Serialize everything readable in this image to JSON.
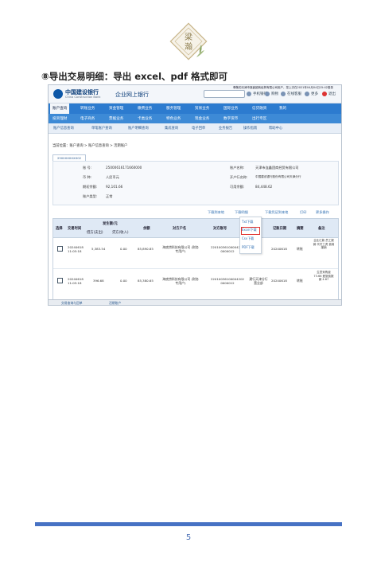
{
  "logo": {
    "text_top": "梁",
    "text_bottom": "瀚",
    "icon": "diamond-leaf-emblem"
  },
  "heading": "⑧导出交易明细：导出 excel、pdf 格式即可",
  "screenshot": {
    "bank_name": "中国建设银行",
    "bank_name_en": "China Construction Bank",
    "portal_name": "企业网上银行",
    "greeting": "尊敬的天津市莲鑫团商经贸有限公司用户，您上次在2021年04月04日15:42登录",
    "top_buttons": [
      "手机银行",
      "购物",
      "在线客服",
      "更多",
      "退出"
    ],
    "menu_row1": [
      "账户查询",
      "转账业务",
      "资金管理",
      "缴费业务",
      "服务管理",
      "贸易业务",
      "国际业务",
      "信贷融资",
      "我的"
    ],
    "menu_row2": [
      "投资理财",
      "电子商务",
      "票据业务",
      "卡类业务",
      "特色业务",
      "现金业务",
      "数字货币",
      "出行专区"
    ],
    "submenu": [
      "账户信息查询",
      "单笔账户查询",
      "账户明细查询",
      "集成查询",
      "电子回单",
      "业务报告",
      "操作指南",
      "帮助中心"
    ],
    "breadcrumb": "当前位置：账户查询 > 账户信息查询 > 活期账户",
    "account_tab": "2500XXXXXX02",
    "info": {
      "account_no_label": "账 号:",
      "account_no": "25000616171660000",
      "currency_label": "币 种:",
      "currency": "人民币元",
      "balance_label": "期初余额:",
      "balance": "92,101.66",
      "alias_label": "账户类型:",
      "alias": "正常",
      "name_label": "账户名称:",
      "name": "天津市连鑫团商经贸有限公司",
      "bank_label": "开户行名称:",
      "bank": "中国建设银行股份有限公司天津分行",
      "avail_label": "可用余额:",
      "avail": "84,448.62"
    },
    "actions": [
      "下载到本地",
      "下载明细",
      "下载凭证到本地",
      "打印",
      "更多操作"
    ],
    "dropdown": [
      "Txt下载",
      "Excel下载",
      "Csv下载",
      "PDF下载"
    ],
    "table": {
      "headers": [
        "选择",
        "交易时间",
        "发生额/元",
        "余额",
        "对方户名",
        "对方账号",
        "记账日期",
        "摘要",
        "备注"
      ],
      "sub_headers": [
        "借方(支出)",
        "贷方(收入)"
      ],
      "rows": [
        {
          "time": "20240618 11:05:18",
          "debit": "5,383.54",
          "credit": "0.00",
          "balance": "85,890.85",
          "counterparty": "海底捞科技有限公司 (财务专用户)",
          "account": "22010036100004202 0000012",
          "bank": "",
          "date": "20240618",
          "summary": "转账",
          "remark": "企业汇款 员工报销 代付工资 费用报销"
        },
        {
          "time": "20240618 11:05:18",
          "debit": "396.68",
          "credit": "0.00",
          "balance": "85,380.65",
          "counterparty": "海底捞科技有限公司 (财务专用户)",
          "account": "22010036100004202 0000012",
          "bank": "建行天津分行营业部",
          "date": "20240618",
          "summary": "转账",
          "remark": "生意采购费 73.66 差旅费报销 4.67"
        }
      ]
    },
    "bottom_tabs": [
      "交易查询与回单",
      "活期账户"
    ]
  },
  "page_number": "5"
}
